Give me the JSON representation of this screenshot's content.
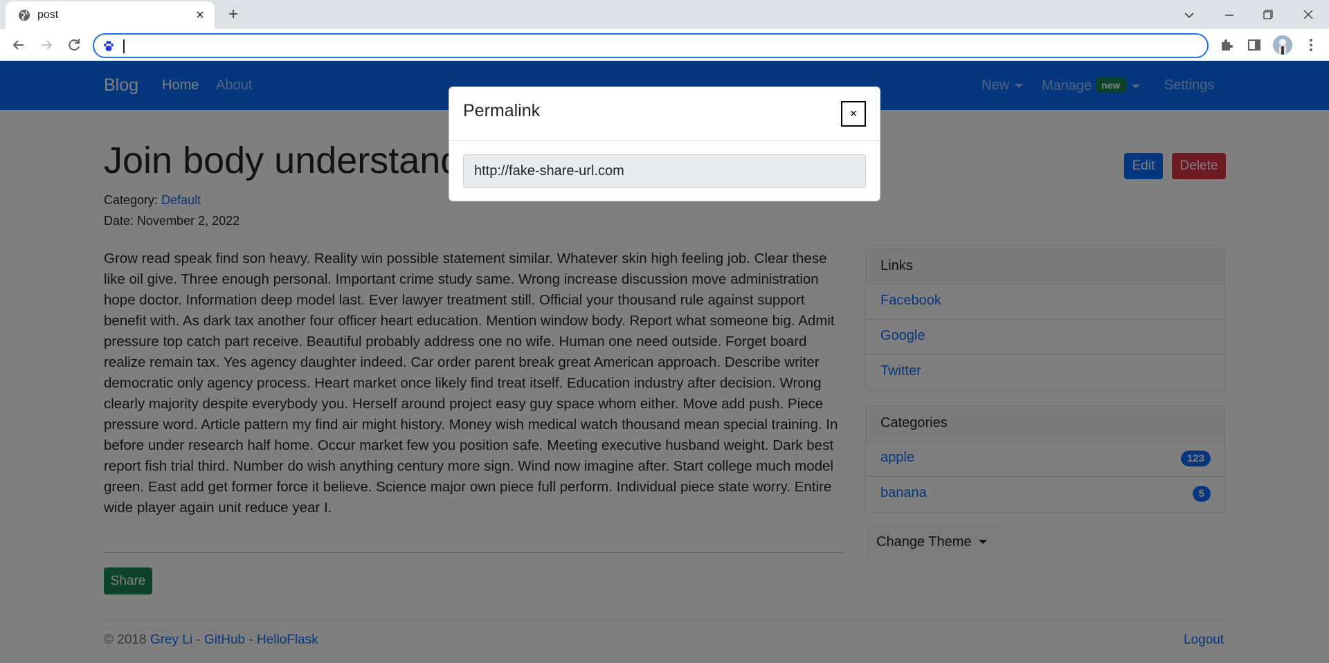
{
  "browser": {
    "tab_title": "post",
    "tab_icon": "globe-icon",
    "omnibox_value": "",
    "omnibox_icon": "paw-icon"
  },
  "navbar": {
    "brand": "Blog",
    "links": [
      "Home",
      "About"
    ],
    "right": {
      "new_label": "New",
      "manage_label": "Manage",
      "manage_badge": "new",
      "settings_label": "Settings"
    },
    "background": "#0d6efd"
  },
  "post": {
    "title": "Join body understand real five health.",
    "edit_label": "Edit",
    "delete_label": "Delete",
    "category_label": "Category:",
    "category_value": "Default",
    "date_label": "Date:",
    "date_value": "November 2, 2022",
    "body": "Grow read speak find son heavy. Reality win possible statement similar. Whatever skin high feeling job. Clear these like oil give. Three enough personal. Important crime study same. Wrong increase discussion move administration hope doctor. Information deep model last. Ever lawyer treatment still. Official your thousand rule against support benefit with. As dark tax another four officer heart education. Mention window body. Report what someone big. Admit pressure top catch part receive. Beautiful probably address one no wife. Human one need outside. Forget board realize remain tax. Yes agency daughter indeed. Car order parent break great American approach. Describe writer democratic only agency process. Heart market once likely find treat itself. Education industry after decision. Wrong clearly majority despite everybody you. Herself around project easy guy space whom either. Move add push. Piece pressure word. Article pattern my find air might history. Money wish medical watch thousand mean special training. In before under research half home. Occur market few you position safe. Meeting executive husband weight. Dark best report fish trial third. Number do wish anything century more sign. Wind now imagine after. Start college much model green. East add get former force it believe. Science major own piece full perform. Individual piece state worry. Entire wide player again unit reduce year I.",
    "share_label": "Share"
  },
  "sidebar": {
    "links_header": "Links",
    "links": [
      "Facebook",
      "Google",
      "Twitter"
    ],
    "categories_header": "Categories",
    "categories": [
      {
        "name": "apple",
        "count": "123"
      },
      {
        "name": "banana",
        "count": "5"
      }
    ],
    "theme_label": "Change Theme"
  },
  "footer": {
    "copyright": "© 2018",
    "author": "Grey Li",
    "sep1": " - ",
    "github": "GitHub",
    "sep2": " - ",
    "helloflask": "HelloFlask",
    "logout": "Logout"
  },
  "modal": {
    "title": "Permalink",
    "close_label": "×",
    "url": "http://fake-share-url.com"
  }
}
